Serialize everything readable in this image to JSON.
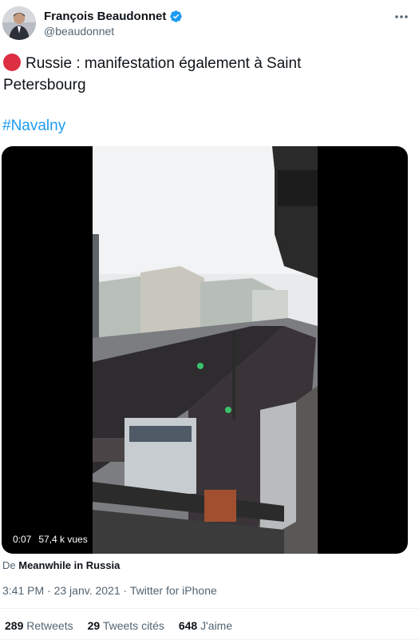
{
  "author": {
    "display_name": "François Beaudonnet",
    "handle": "@beaudonnet",
    "verified": true
  },
  "tweet": {
    "line1": "Russie : manifestation  également à Saint",
    "line2": "Petersbourg",
    "hashtag": "#Navalny",
    "emoji_icon": "red-circle-icon"
  },
  "video": {
    "time": "0:07",
    "views": "57,4 k vues"
  },
  "source": {
    "prefix": "De",
    "name": "Meanwhile in Russia"
  },
  "meta": {
    "time": "3:41 PM",
    "separator1": "·",
    "date": "23 janv. 2021",
    "separator2": "·",
    "client": "Twitter for iPhone"
  },
  "stats": {
    "retweets_count": "289",
    "retweets_label": "Retweets",
    "quotes_count": "29",
    "quotes_label": "Tweets cités",
    "likes_count": "648",
    "likes_label": "J'aime"
  },
  "colors": {
    "accent": "#1d9bf0",
    "red_dot": "#dd2e44",
    "secondary_text": "#536471"
  }
}
